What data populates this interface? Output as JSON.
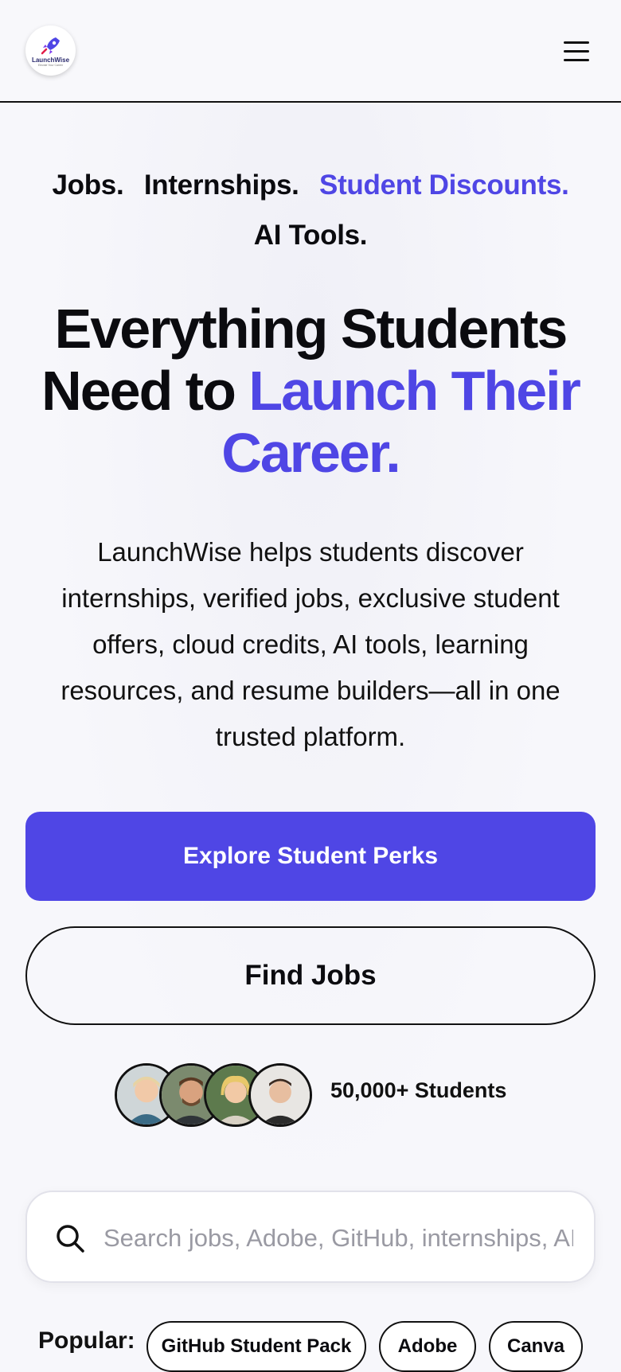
{
  "header": {
    "logo_text": "LaunchWise",
    "logo_sub": "Elevate Your Career",
    "menu_icon": "hamburger-menu-icon"
  },
  "hero": {
    "tagline_line1": [
      "Jobs.",
      "Internships.",
      "Student Discounts."
    ],
    "tagline_line2": "AI Tools.",
    "headline_part1": "Everything Students",
    "headline_part2": "Need to",
    "headline_accent1": "Launch Their",
    "headline_accent2": "Career.",
    "description": "LaunchWise helps students discover internships, verified jobs, exclusive student offers, cloud credits, AI tools, learning resources, and resume builders—all in one trusted platform.",
    "primary_button": "Explore Student Perks",
    "secondary_button": "Find Jobs",
    "students_count": "50,000+ Students"
  },
  "search": {
    "placeholder": "Search jobs, Adobe, GitHub, internships, AI tools...",
    "icon": "search-icon"
  },
  "popular": {
    "label": "Popular:",
    "chips": [
      "GitHub Student Pack",
      "Adobe",
      "Canva"
    ]
  },
  "colors": {
    "accent": "#4f46e5",
    "text": "#0b0b0f",
    "background": "#f7f7fb"
  }
}
